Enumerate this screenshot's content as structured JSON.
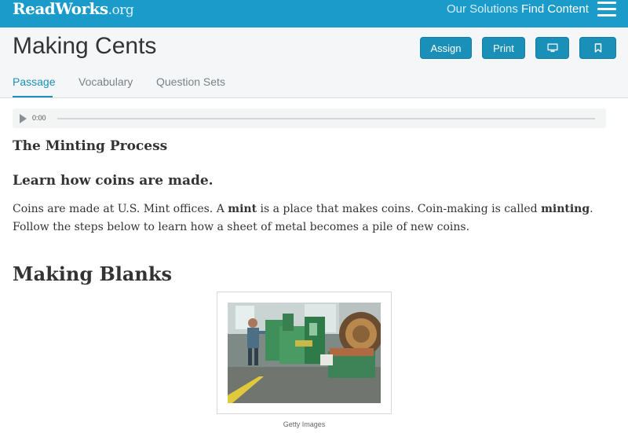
{
  "brand": {
    "logo_main": "ReadWorks",
    "logo_suffix": ".org"
  },
  "topnav": {
    "our_solutions": "Our Solutions",
    "find_content": "Find Content"
  },
  "header": {
    "title": "Making Cents",
    "assign_label": "Assign",
    "print_label": "Print"
  },
  "tabs": [
    {
      "label": "Passage",
      "active": true
    },
    {
      "label": "Vocabulary",
      "active": false
    },
    {
      "label": "Question Sets",
      "active": false
    }
  ],
  "audio": {
    "time": "0:00",
    "progress": 0
  },
  "passage": {
    "section_title": "The Minting Process",
    "subtitle": "Learn how coins are made.",
    "paragraph": {
      "p1": "Coins are made at U.S. Mint offices. A ",
      "b1": "mint",
      "p2": " is a place that makes coins. Coin-making is called ",
      "b2": "minting",
      "p3": ". Follow the steps below to learn how a sheet of metal becomes a pile of new coins."
    },
    "heading2": "Making Blanks",
    "figure": {
      "caption": "Getty Images"
    }
  },
  "colors": {
    "brand_blue": "#1a9bc9",
    "button_blue": "#1a8fb8",
    "header_bg": "#f4f6f7"
  }
}
